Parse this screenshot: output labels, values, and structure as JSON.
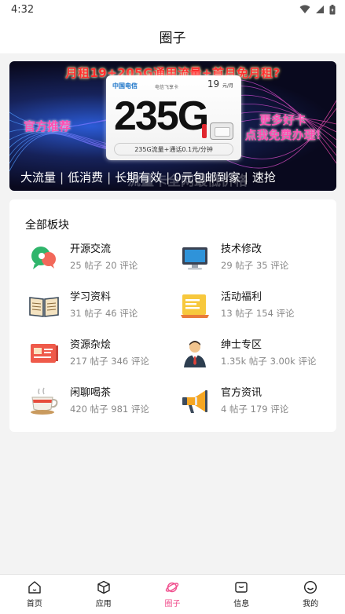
{
  "status_bar": {
    "time": "4:32",
    "icons": [
      "wifi-icon",
      "signal-icon",
      "battery-icon"
    ]
  },
  "header": {
    "title": "圈子"
  },
  "banner": {
    "headline": "月租19+205G通用流量+首月免月租?",
    "left_text": "官方推荐",
    "right_text_line1": "更多好卡",
    "right_text_line2": "点我免费办理!",
    "sim": {
      "logo": "中国电信",
      "type": "电信飞享卡",
      "price": "19",
      "price_unit": "元/月",
      "big": "235G",
      "footer": "235G流量+通话0.1元/分钟"
    },
    "tags": [
      "大流量",
      "低消费",
      "长期有效",
      "0元包邮到家",
      "速抢"
    ],
    "ghost_text": "流量卡全网最低价格"
  },
  "boards_section": {
    "title": "全部板块",
    "items": [
      {
        "name": "开源交流",
        "posts": "25 帖子 20 评论",
        "icon": "chat-bubble-icon"
      },
      {
        "name": "技术修改",
        "posts": "29 帖子 35 评论",
        "icon": "monitor-icon"
      },
      {
        "name": "学习资料",
        "posts": "31 帖子 46 评论",
        "icon": "open-book-icon"
      },
      {
        "name": "活动福利",
        "posts": "13 帖子 154 评论",
        "icon": "gift-card-icon"
      },
      {
        "name": "资源杂烩",
        "posts": "217 帖子 346 评论",
        "icon": "slideshow-icon"
      },
      {
        "name": "绅士专区",
        "posts": "1.35k 帖子 3.00k 评论",
        "icon": "gentleman-icon"
      },
      {
        "name": "闲聊喝茶",
        "posts": "420 帖子 981 评论",
        "icon": "tea-cup-icon"
      },
      {
        "name": "官方资讯",
        "posts": "4 帖子 179 评论",
        "icon": "megaphone-icon"
      }
    ]
  },
  "tabbar": {
    "items": [
      {
        "label": "首页",
        "icon": "home-icon"
      },
      {
        "label": "应用",
        "icon": "cube-icon"
      },
      {
        "label": "圈子",
        "icon": "planet-icon",
        "active": true
      },
      {
        "label": "信息",
        "icon": "message-icon"
      },
      {
        "label": "我的",
        "icon": "smile-icon"
      }
    ]
  },
  "colors": {
    "accent": "#f0508e",
    "meta_text": "#888888",
    "page_bg": "#f3f3f3"
  }
}
